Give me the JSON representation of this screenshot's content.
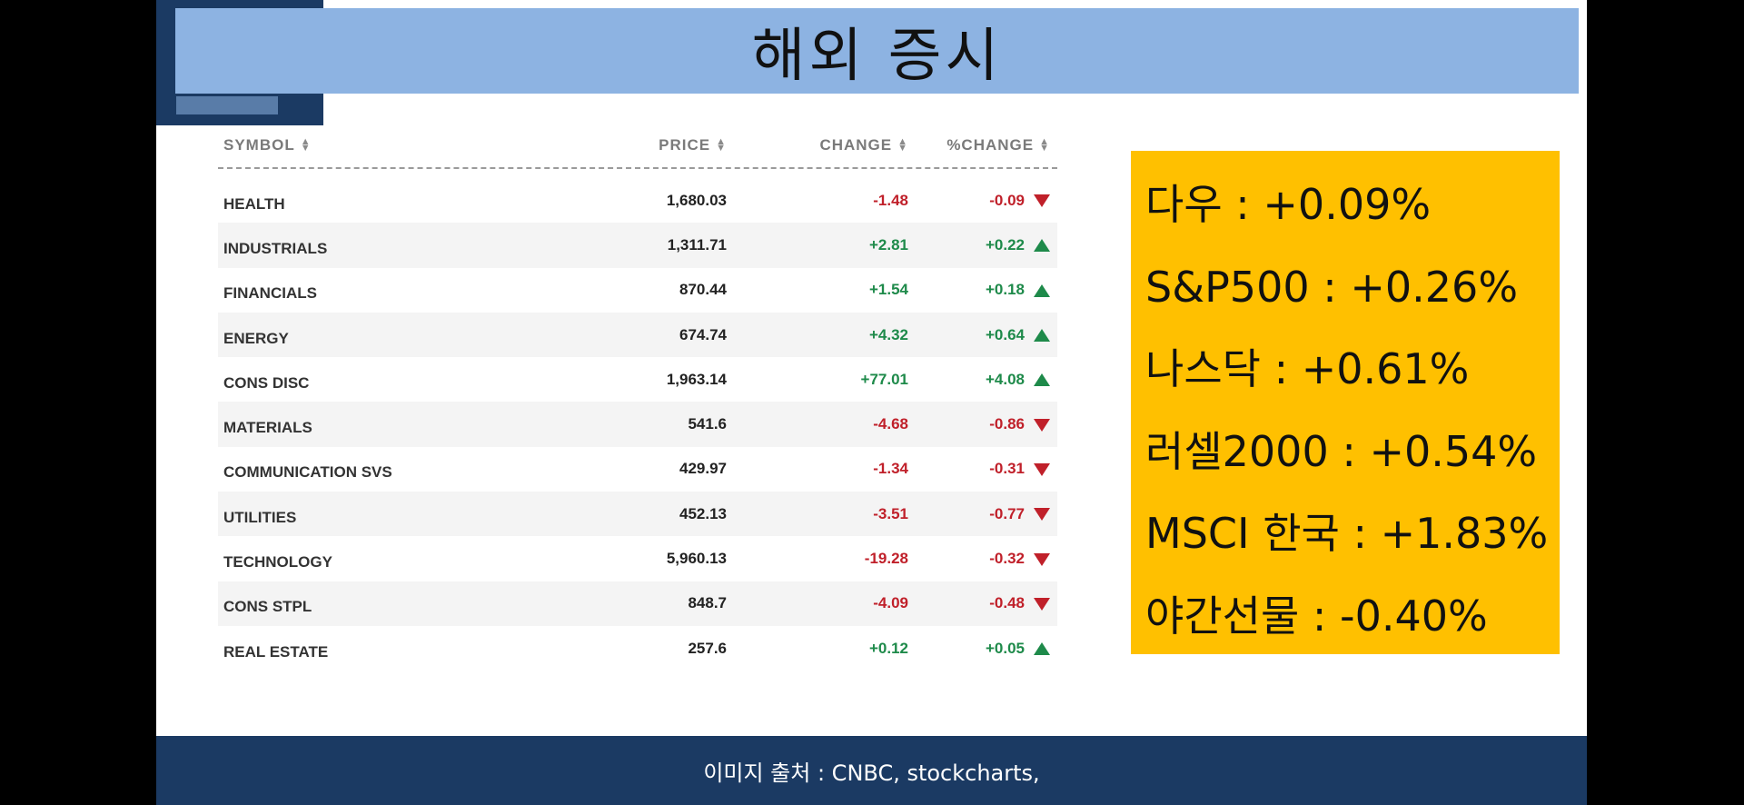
{
  "title": "해외 증시",
  "table": {
    "headers": {
      "symbol": "SYMBOL",
      "price": "PRICE",
      "change": "CHANGE",
      "pct_change": "%CHANGE"
    },
    "sort_icon": "sort-updown-icon",
    "rows": [
      {
        "symbol": "HEALTH",
        "price": "1,680.03",
        "change": "-1.48",
        "pct": "-0.09",
        "direction": "down"
      },
      {
        "symbol": "INDUSTRIALS",
        "price": "1,311.71",
        "change": "+2.81",
        "pct": "+0.22",
        "direction": "up"
      },
      {
        "symbol": "FINANCIALS",
        "price": "870.44",
        "change": "+1.54",
        "pct": "+0.18",
        "direction": "up"
      },
      {
        "symbol": "ENERGY",
        "price": "674.74",
        "change": "+4.32",
        "pct": "+0.64",
        "direction": "up"
      },
      {
        "symbol": "CONS DISC",
        "price": "1,963.14",
        "change": "+77.01",
        "pct": "+4.08",
        "direction": "up"
      },
      {
        "symbol": "MATERIALS",
        "price": "541.6",
        "change": "-4.68",
        "pct": "-0.86",
        "direction": "down"
      },
      {
        "symbol": "COMMUNICATION SVS",
        "price": "429.97",
        "change": "-1.34",
        "pct": "-0.31",
        "direction": "down"
      },
      {
        "symbol": "UTILITIES",
        "price": "452.13",
        "change": "-3.51",
        "pct": "-0.77",
        "direction": "down"
      },
      {
        "symbol": "TECHNOLOGY",
        "price": "5,960.13",
        "change": "-19.28",
        "pct": "-0.32",
        "direction": "down"
      },
      {
        "symbol": "CONS STPL",
        "price": "848.7",
        "change": "-4.09",
        "pct": "-0.48",
        "direction": "down"
      },
      {
        "symbol": "REAL ESTATE",
        "price": "257.6",
        "change": "+0.12",
        "pct": "+0.05",
        "direction": "up"
      }
    ]
  },
  "summary": [
    "다우 : +0.09%",
    "S&P500 : +0.26%",
    "나스닥  : +0.61%",
    "러셀2000 : +0.54%",
    "MSCI 한국 : +1.83%",
    "야간선물 : -0.40%"
  ],
  "footer": "이미지 출처  : CNBC, stockcharts,",
  "colors": {
    "title_bar": "#8db3e2",
    "summary_box": "#ffc000",
    "footer_bar": "#1b3a63",
    "positive": "#1e8a4a",
    "negative": "#c0202a"
  }
}
